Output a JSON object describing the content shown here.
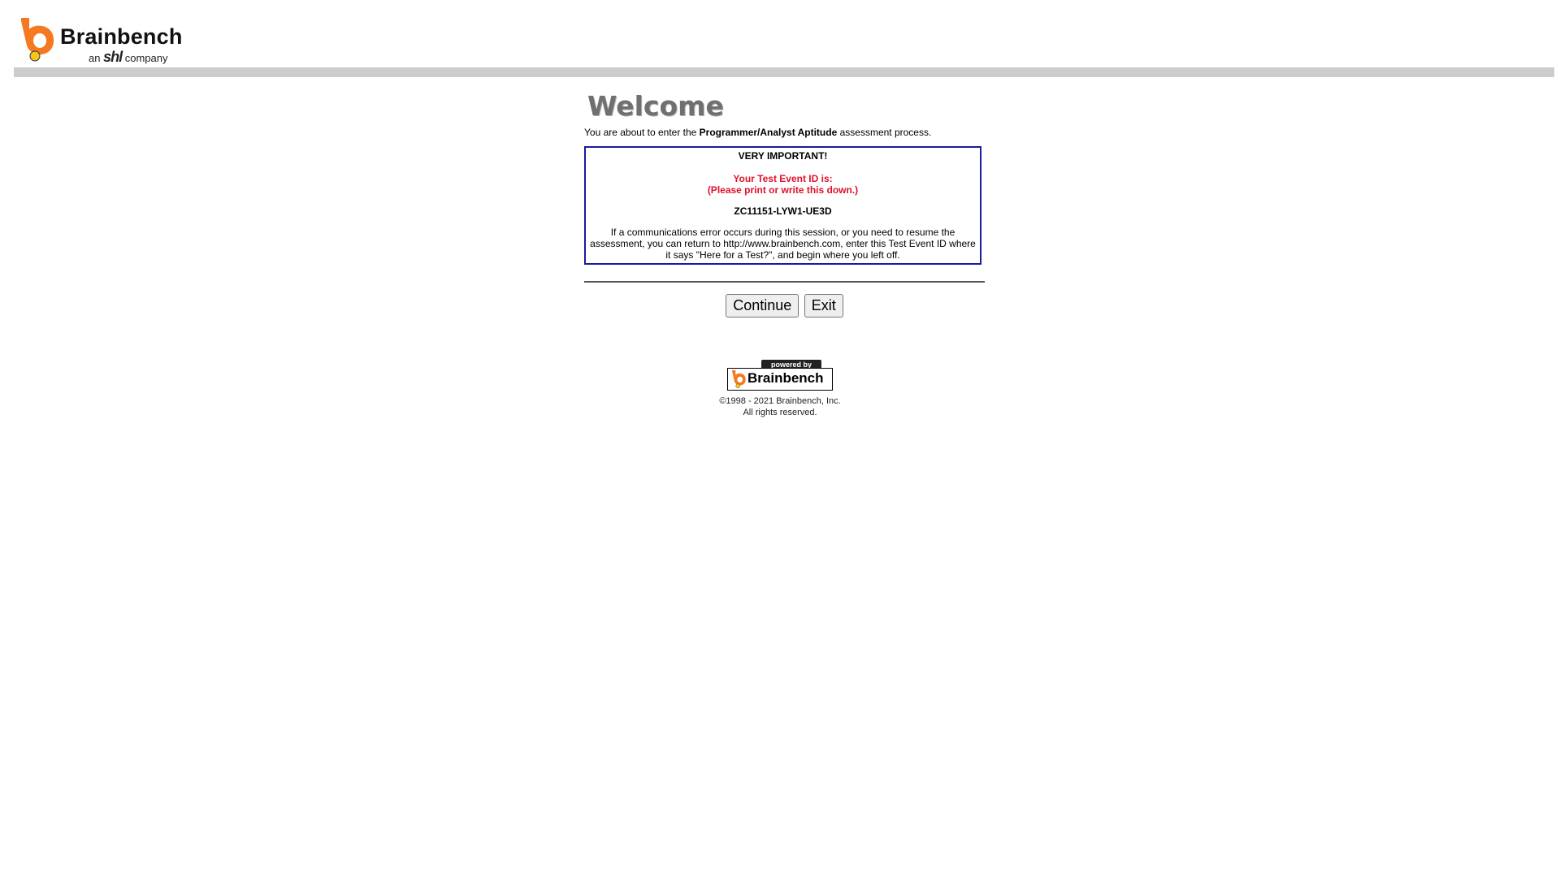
{
  "header": {
    "logo_name": "Brainbench",
    "logo_sub_prefix": "an",
    "logo_sub_brand": "shl",
    "logo_sub_suffix": "company",
    "logo_color_orange": "#f47920",
    "logo_color_yellow": "#f6c51c"
  },
  "main": {
    "title": "Welcome",
    "intro_before": "You are about to enter the ",
    "intro_assessment": "Programmer/Analyst Aptitude",
    "intro_after": " assessment process.",
    "important": {
      "heading": "VERY IMPORTANT!",
      "id_label": "Your Test Event ID is:",
      "id_instruction": "(Please print or write this down.)",
      "event_id": "ZC11151-LYW1-UE3D",
      "note": "If a communications error occurs during this session, or you need to resume the assessment, you can return to http://www.brainbench.com, enter this Test Event ID where it says \"Here for a Test?\", and begin where you left off."
    },
    "buttons": {
      "continue_label": "Continue",
      "exit_label": "Exit"
    }
  },
  "footer": {
    "powered_by": "powered by",
    "powered_brand": "Brainbench",
    "copyright": "©1998 - 2021 Brainbench, Inc.",
    "rights": "All rights reserved."
  }
}
